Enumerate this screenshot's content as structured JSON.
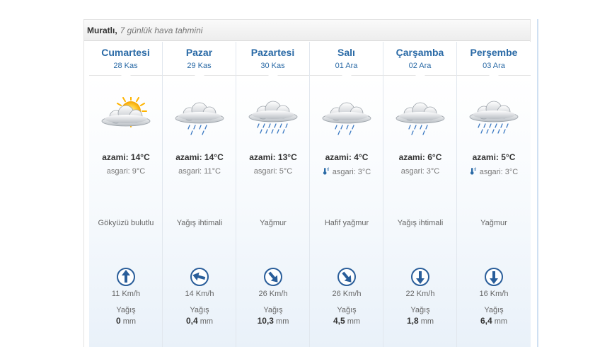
{
  "header": {
    "location": "Muratlı,",
    "subtitle": "7 günlük hava tahmini"
  },
  "days": [
    {
      "name": "Cumartesi",
      "date": "28 Kas",
      "icon": "partly-cloudy-sun-icon",
      "max": "azami: 14°C",
      "min": "asgari: 9°C",
      "cold": false,
      "desc": "Gökyüzü bulutlu",
      "wind_dir": "north",
      "wind_rotation_deg": 0,
      "wind": "11 Km/h",
      "rain_label": "Yağış",
      "rain_amount": "0",
      "rain_unit": "mm"
    },
    {
      "name": "Pazar",
      "date": "29 Kas",
      "icon": "cloud-light-rain-icon",
      "max": "azami: 14°C",
      "min": "asgari: 11°C",
      "cold": false,
      "desc": "Yağış ihtimali",
      "wind_dir": "west-northwest",
      "wind_rotation_deg": 285,
      "wind": "14 Km/h",
      "rain_label": "Yağış",
      "rain_amount": "0,4",
      "rain_unit": "mm"
    },
    {
      "name": "Pazartesi",
      "date": "30 Kas",
      "icon": "cloud-rain-icon",
      "max": "azami: 13°C",
      "min": "asgari: 5°C",
      "cold": false,
      "desc": "Yağmur",
      "wind_dir": "southeast",
      "wind_rotation_deg": 140,
      "wind": "26 Km/h",
      "rain_label": "Yağış",
      "rain_amount": "10,3",
      "rain_unit": "mm"
    },
    {
      "name": "Salı",
      "date": "01 Ara",
      "icon": "cloud-light-rain-icon",
      "max": "azami: 4°C",
      "min": "asgari: 3°C",
      "cold": true,
      "desc": "Hafif yağmur",
      "wind_dir": "southeast",
      "wind_rotation_deg": 140,
      "wind": "26 Km/h",
      "rain_label": "Yağış",
      "rain_amount": "4,5",
      "rain_unit": "mm"
    },
    {
      "name": "Çarşamba",
      "date": "02 Ara",
      "icon": "cloud-light-rain-icon",
      "max": "azami: 6°C",
      "min": "asgari: 3°C",
      "cold": false,
      "desc": "Yağış ihtimali",
      "wind_dir": "south",
      "wind_rotation_deg": 180,
      "wind": "22 Km/h",
      "rain_label": "Yağış",
      "rain_amount": "1,8",
      "rain_unit": "mm"
    },
    {
      "name": "Perşembe",
      "date": "03 Ara",
      "icon": "cloud-rain-icon",
      "max": "azami: 5°C",
      "min": "asgari: 3°C",
      "cold": true,
      "desc": "Yağmur",
      "wind_dir": "south",
      "wind_rotation_deg": 180,
      "wind": "16 Km/h",
      "rain_label": "Yağış",
      "rain_amount": "6,4",
      "rain_unit": "mm"
    }
  ],
  "colors": {
    "accent": "#2a6aa6",
    "wind_icon": "#2a5e9a",
    "cold_icon": "#2a6aa6"
  }
}
